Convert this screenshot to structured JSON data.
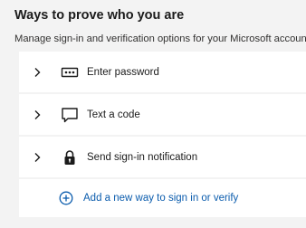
{
  "section": {
    "title": "Ways to prove who you are",
    "subtitle": "Manage sign-in and verification options for your Microsoft account."
  },
  "methods": [
    {
      "label": "Enter password",
      "icon": "password-dots-icon"
    },
    {
      "label": "Text a code",
      "icon": "chat-bubble-icon"
    },
    {
      "label": "Send sign-in notification",
      "icon": "lock-icon"
    }
  ],
  "add_method": {
    "label": "Add a new way to sign in or verify",
    "icon": "plus-circle-icon"
  },
  "colors": {
    "background": "#f3f3f3",
    "card": "#ffffff",
    "link": "#0b5cad"
  }
}
